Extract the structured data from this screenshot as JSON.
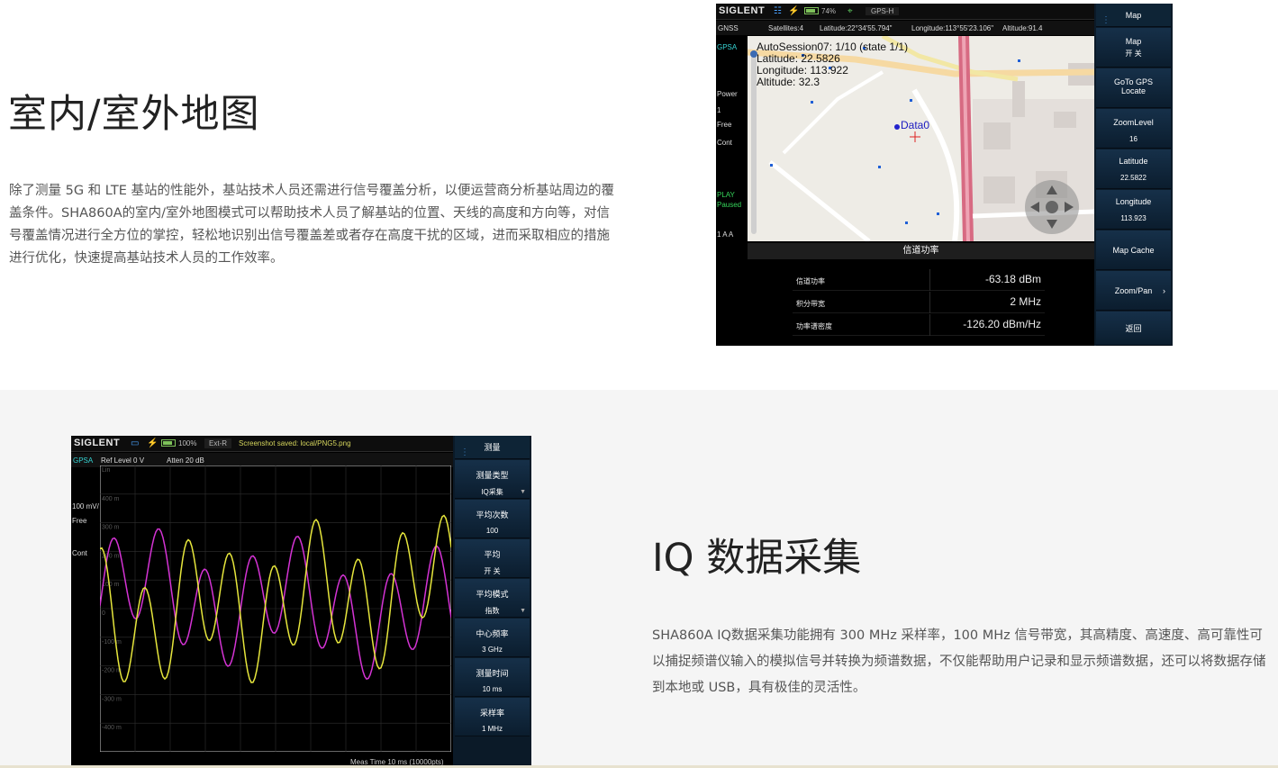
{
  "section1": {
    "title": "室内/室外地图",
    "description": "除了测量 5G 和 LTE 基站的性能外，基站技术人员还需进行信号覆盖分析，以便运营商分析基站周边的覆盖条件。SHA860A的室内/室外地图模式可以帮助技术人员了解基站的位置、天线的高度和方向等，对信号覆盖情况进行全方位的掌控，轻松地识别出信号覆盖差或者存在高度干扰的区域，进而采取相应的措施进行优化，快速提高基站技术人员的工作效率。"
  },
  "screen1": {
    "logo": "SIGLENT",
    "battery": "74%",
    "mode": "GPS-H",
    "gnss_label": "GNSS",
    "satellites": "Satellites:4",
    "latitude": "Latitude:22°34'55.794\"",
    "longitude": "Longitude:113°55'23.106\"",
    "altitude": "Altitude:91.4",
    "left": {
      "mode": "GPSA",
      "power": "Power",
      "one": "1",
      "free": "Free",
      "cont": "Cont",
      "play": "PLAY",
      "paused": "Paused",
      "trace": "1 A A"
    },
    "map_info": {
      "session": "AutoSession07: 1/10 (state 1/1)",
      "lat": "Latitude: 22.5826",
      "lon": "Longitude: 113.922",
      "alt": "Altitude: 32.3",
      "marker": "Data0"
    },
    "panel": {
      "title": "信道功率",
      "rows": [
        {
          "label": "信道功率",
          "value": "-63.18 dBm"
        },
        {
          "label": "积分带宽",
          "value": "2 MHz"
        },
        {
          "label": "功率谱密度",
          "value": "-126.20 dBm/Hz"
        }
      ]
    },
    "softkeys": {
      "header": "Map",
      "map": "Map",
      "map_sub": "开 关",
      "goto": "GoTo GPS",
      "goto2": "Locate",
      "zoom": "ZoomLevel",
      "zoom_sub": "16",
      "lat": "Latitude",
      "lat_sub": "22.5822",
      "lon": "Longitude",
      "lon_sub": "113.923",
      "cache": "Map Cache",
      "pan": "Zoom/Pan",
      "back": "返回"
    }
  },
  "section2": {
    "title": "IQ 数据采集",
    "description": "SHA860A IQ数据采集功能拥有 300 MHz 采样率，100 MHz 信号带宽，其高精度、高速度、高可靠性可以捕捉频谱仪输入的模拟信号并转换为频谱数据，不仅能帮助用户记录和显示频谱数据，还可以将数据存储到本地或 USB，具有极佳的灵活性。"
  },
  "screen2": {
    "logo": "SIGLENT",
    "battery": "100%",
    "ext": "Ext-R",
    "saved": "Screenshot saved: local/PNG5.png",
    "gpsa": "GPSA",
    "ref": "Ref Level  0 V",
    "atten": "Atten  20 dB",
    "left": {
      "scale": "100 mV/",
      "free": "Free",
      "cont": "Cont"
    },
    "y_labels": [
      "Lin",
      "400 m",
      "300 m",
      "200 m",
      "100 m",
      "0",
      "-100 m",
      "-200 m",
      "-300 m",
      "-400 m"
    ],
    "meas_time": "Meas Time  10 ms (10000pts)",
    "softkeys": {
      "header": "测量",
      "type": "测量类型",
      "type_sub": "IQ采集",
      "avg_count": "平均次数",
      "avg_count_sub": "100",
      "avg": "平均",
      "avg_sub": "开 关",
      "avg_mode": "平均模式",
      "avg_mode_sub": "指数",
      "center": "中心频率",
      "center_sub": "3 GHz",
      "time": "测量时间",
      "time_sub": "10 ms",
      "rate": "采样率",
      "rate_sub": "1 MHz"
    }
  },
  "colors": {
    "trace_i": "#e6e63c",
    "trace_q": "#d433d4",
    "softkey_bg": "#163049",
    "accent_green": "#35d35a"
  }
}
